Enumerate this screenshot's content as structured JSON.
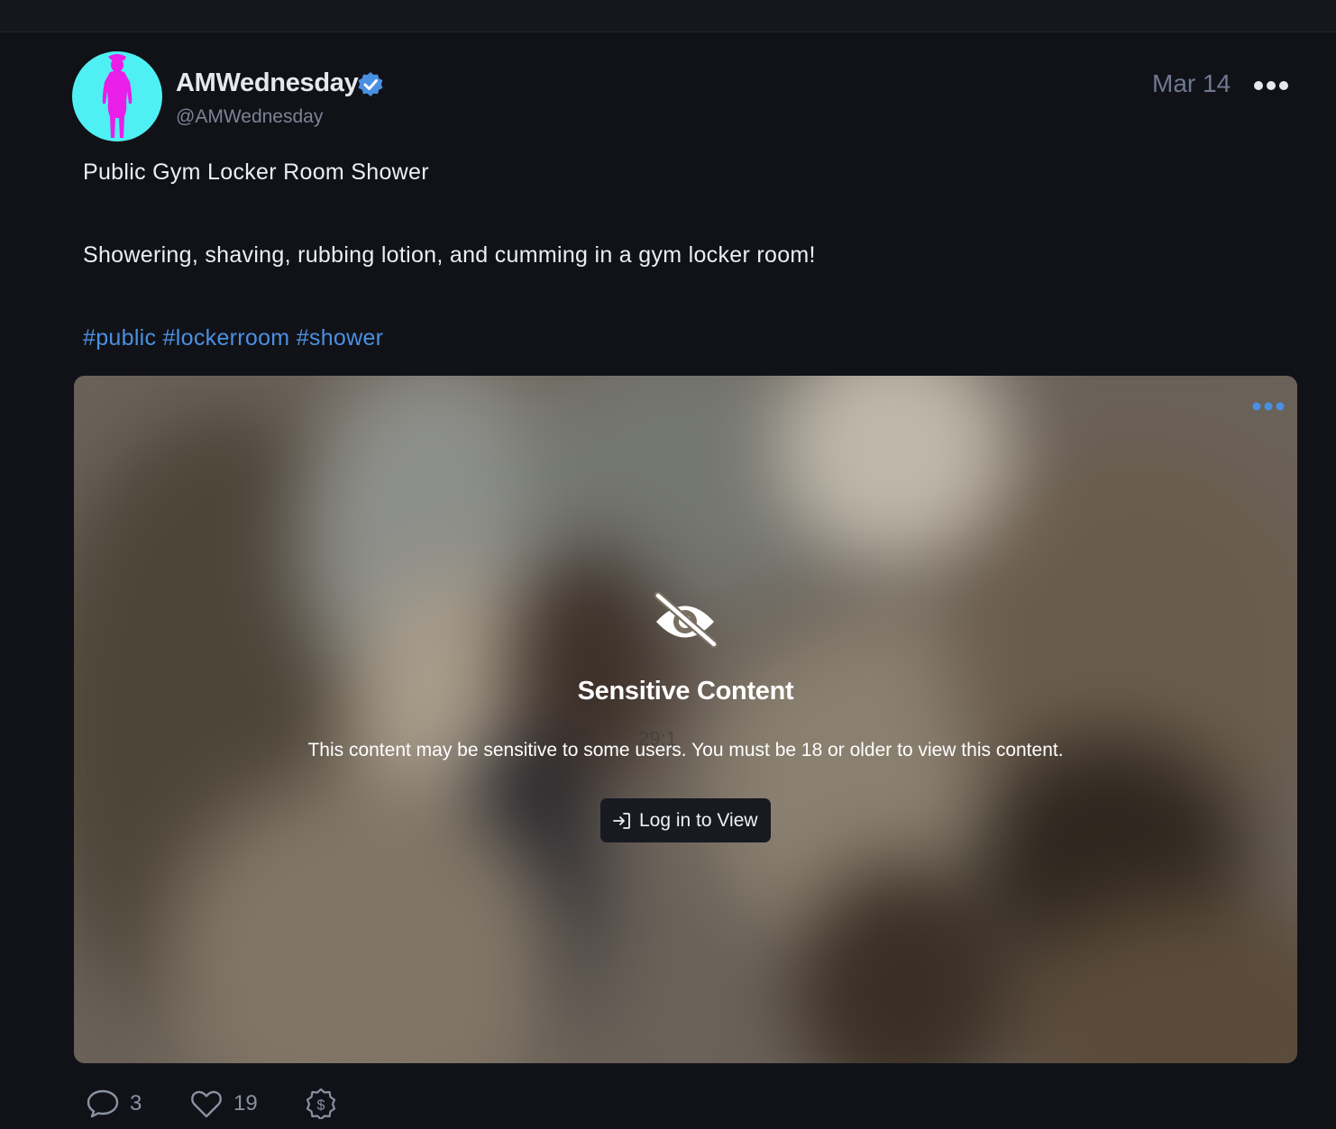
{
  "post": {
    "author": {
      "display_name": "AMWednesday",
      "handle": "@AMWednesday",
      "verified": true,
      "avatar_bg": "#4ff0f4",
      "avatar_figure_color": "#e91ee8"
    },
    "date": "Mar 14",
    "title": "Public Gym Locker Room Shower",
    "body": "Showering, shaving, rubbing lotion, and cumming in a gym locker room!",
    "hashtags": [
      "#public",
      "#lockerroom",
      "#shower"
    ],
    "hashtag_color": "#4a90e2"
  },
  "media": {
    "sensitive_title": "Sensitive Content",
    "sensitive_description": "This content may be sensitive to some users. You must be 18 or older to view this content.",
    "login_button": "Log in to View",
    "ghost_duration": "29:1",
    "icons": [
      "eye-slash-icon",
      "more-icon",
      "login-icon"
    ]
  },
  "actions": {
    "comments": "3",
    "likes": "19",
    "icons": [
      "comment-icon",
      "heart-icon",
      "tip-icon"
    ]
  }
}
